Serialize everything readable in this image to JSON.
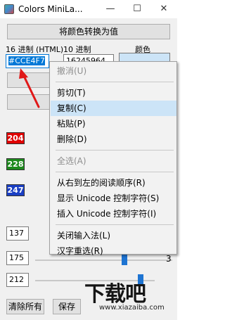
{
  "window": {
    "title": "Colors MiniLa...",
    "minimize_glyph": "—",
    "maximize_glyph": "☐",
    "close_glyph": "✕"
  },
  "convert_button": "将颜色转换为值",
  "hex": {
    "label": "16 进制 (HTML)",
    "value": "#CCE4F7"
  },
  "dec": {
    "label": "10 进制",
    "value": "16245964"
  },
  "preview": {
    "label": "颜色",
    "color": "#cce4f7"
  },
  "channels": {
    "red": {
      "value": "204",
      "color": "#e00000"
    },
    "green": {
      "value": "228",
      "color": "#1d8a1d"
    },
    "blue": {
      "value": "247",
      "color": "#1a3fc4"
    }
  },
  "extra_fields": [
    "137",
    "175",
    "212"
  ],
  "extra_suffix": "3",
  "buttons": {
    "clear_all": "清除所有",
    "save": "保存"
  },
  "context_menu": [
    {
      "label": "撤消(U)",
      "disabled": true
    },
    {
      "sep": true
    },
    {
      "label": "剪切(T)",
      "disabled": false
    },
    {
      "label": "复制(C)",
      "disabled": false,
      "hover": true
    },
    {
      "label": "粘贴(P)",
      "disabled": false
    },
    {
      "label": "删除(D)",
      "disabled": false
    },
    {
      "sep": true
    },
    {
      "label": "全选(A)",
      "disabled": true
    },
    {
      "sep": true
    },
    {
      "label": "从右到左的阅读顺序(R)",
      "disabled": false
    },
    {
      "label": "显示 Unicode 控制字符(S)",
      "disabled": false
    },
    {
      "label": "插入 Unicode 控制字符(I)",
      "disabled": false
    },
    {
      "sep": true
    },
    {
      "label": "关闭输入法(L)",
      "disabled": false
    },
    {
      "label": "汉字重选(R)",
      "disabled": false
    }
  ],
  "watermark": {
    "text": "下载吧",
    "url": "www.xiazaiba.com"
  }
}
